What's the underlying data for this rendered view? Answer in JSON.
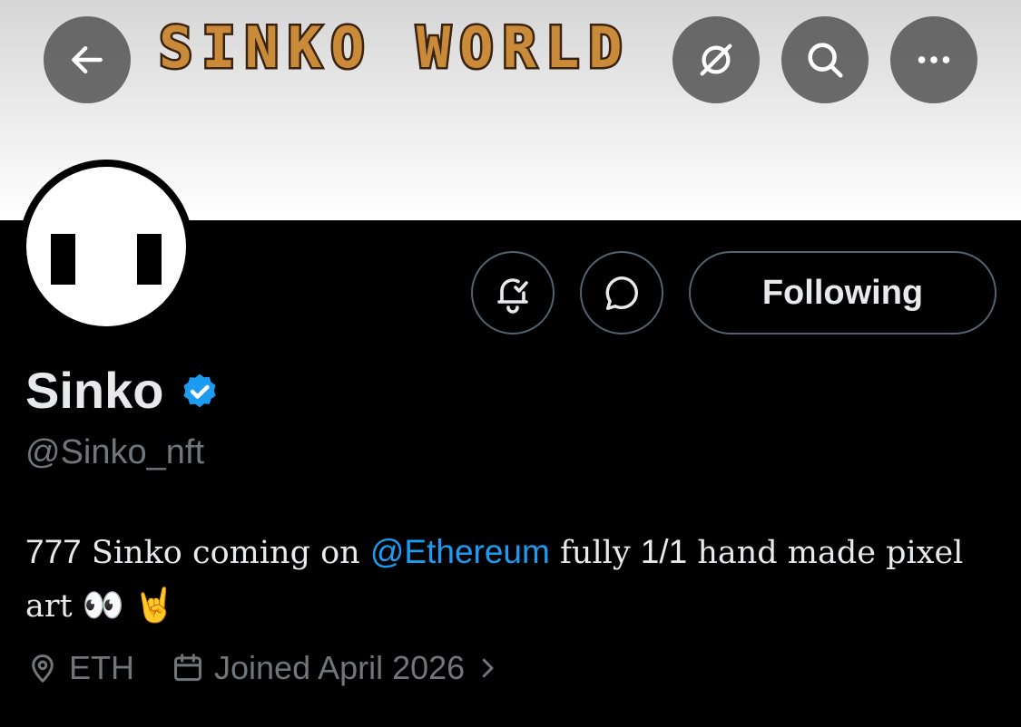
{
  "banner": {
    "title": "SINKO WORLD",
    "colors": {
      "text": "#c98a3a",
      "outline": "#3a2410"
    }
  },
  "nav": {
    "back_icon": "arrow-left-icon",
    "grok_icon": "grok-icon",
    "search_icon": "search-icon",
    "more_icon": "more-horizontal-icon"
  },
  "actions": {
    "notify_icon": "bell-check-icon",
    "message_icon": "message-bubble-icon",
    "following_label": "Following"
  },
  "profile": {
    "name": "Sinko",
    "verified_icon": "verified-badge-icon",
    "handle": "@Sinko_nft",
    "bio": {
      "count": "777",
      "text_1": " Sinko coming on ",
      "mention": "@Ethereum",
      "text_2": " fully ",
      "ratio": "1/1",
      "text_3": " hand made pixel art ",
      "emoji": "👀 🤘"
    },
    "location": "ETH",
    "joined": "Joined April 2026"
  },
  "colors": {
    "accent": "#1d9bf0",
    "muted": "#71767b",
    "text": "#e7e9ea",
    "border": "#536471"
  }
}
